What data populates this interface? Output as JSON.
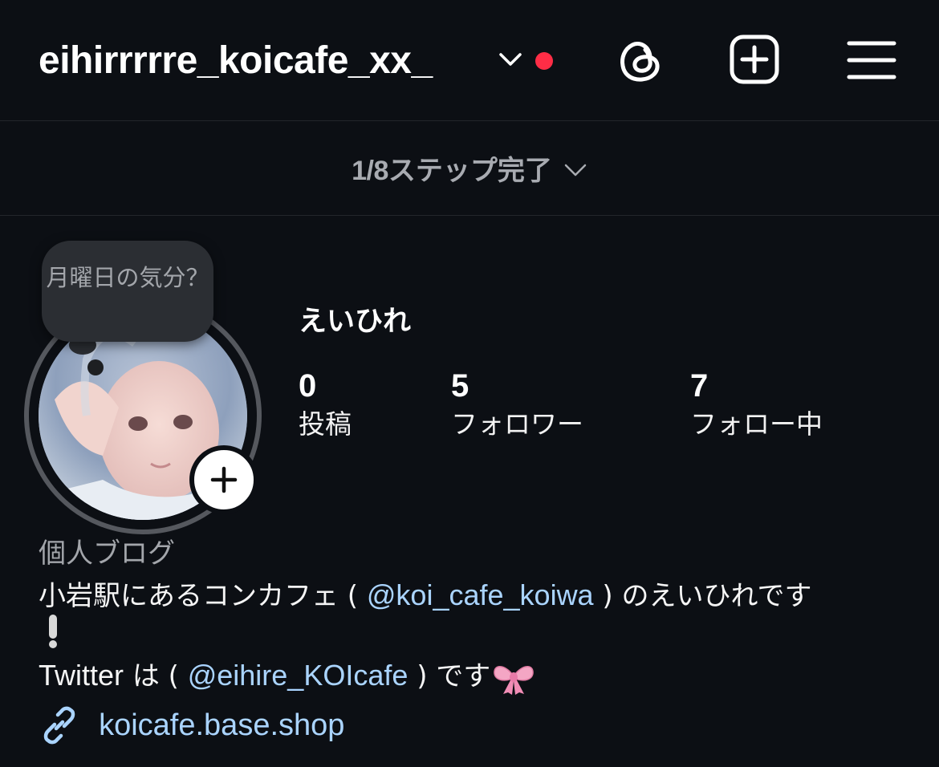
{
  "header": {
    "username": "eihirrrrre_koicafe_xx_",
    "has_notification_dot": true,
    "icons": [
      "chevron-down-icon",
      "threads-icon",
      "create-post-icon",
      "menu-icon"
    ]
  },
  "steps_bar": {
    "count": "1/8",
    "label": "ステップ完了"
  },
  "note": {
    "text": "月曜日の気分？"
  },
  "profile": {
    "display_name": "えいひれ",
    "stats": {
      "posts": {
        "value": "0",
        "label": "投稿"
      },
      "followers": {
        "value": "5",
        "label": "フォロワー"
      },
      "following": {
        "value": "7",
        "label": "フォロー中"
      }
    }
  },
  "bio": {
    "category": "個人ブログ",
    "line1_prefix": "小岩駅にあるコンカフェ ( ",
    "line1_mention": "@koi_cafe_koiwa",
    "line1_suffix": " ) のえいひれです",
    "line2_emoji": "heavy-exclamation-mark",
    "line3_twitter": "Twitter",
    "line3_mid": " は ( ",
    "line3_mention": "@eihire_KOIcafe",
    "line3_suffix": " ) です",
    "line3_emoji": "ribbon-icon",
    "link": "koicafe.base.shop"
  },
  "colors": {
    "background": "#0c0f14",
    "link": "#aad4ff",
    "notification_dot": "#ff2d46",
    "muted_text": "#a3a6ab"
  }
}
